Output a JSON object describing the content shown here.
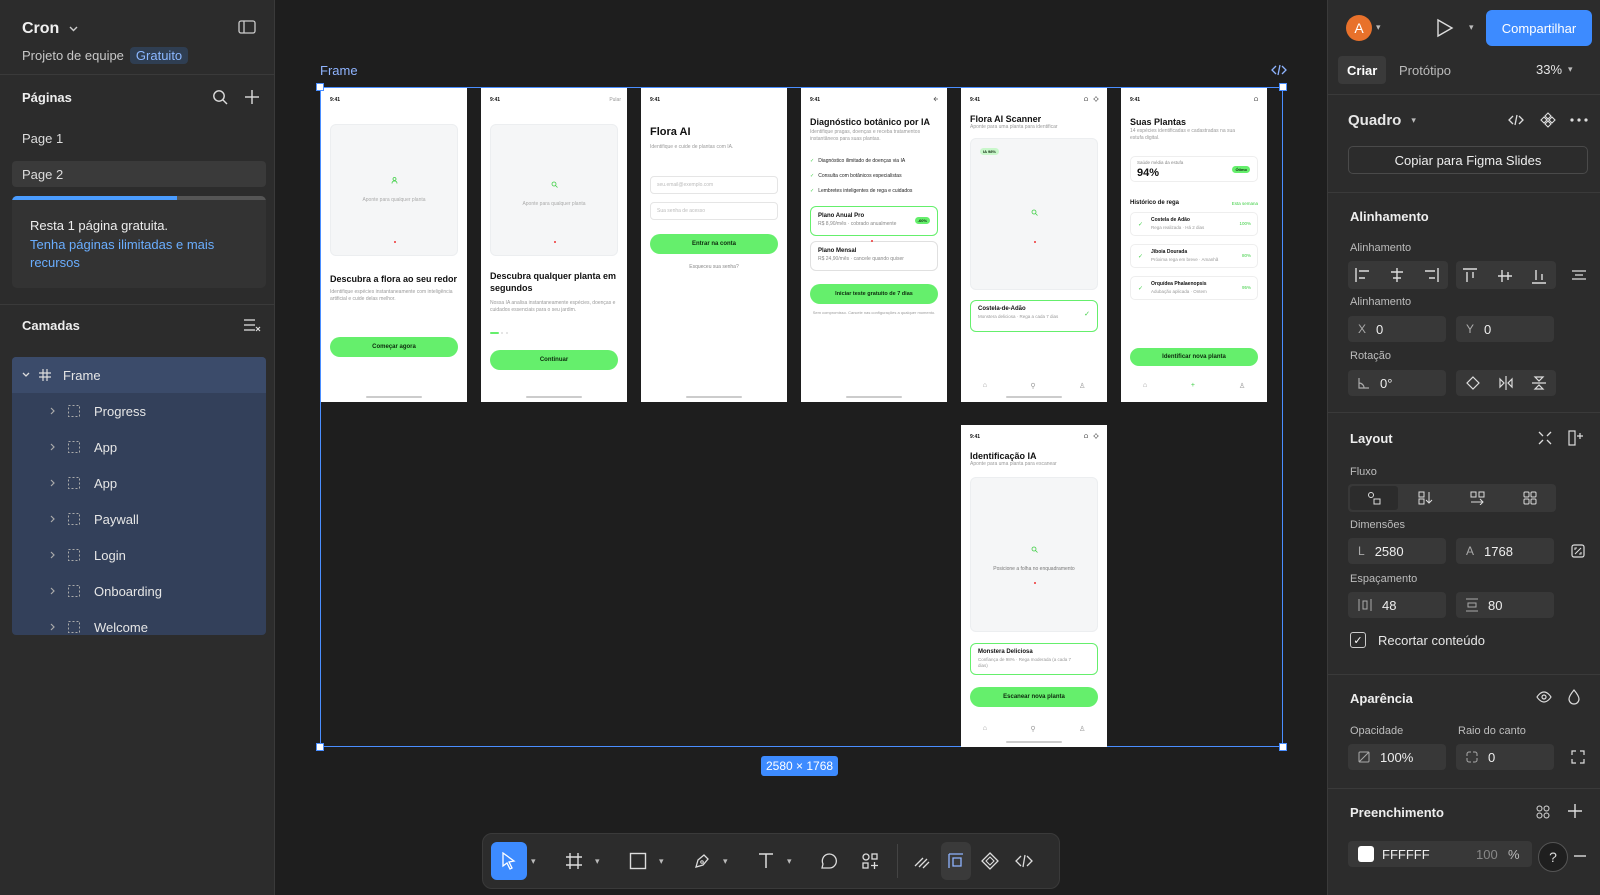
{
  "file": {
    "name": "Cron",
    "project": "Projeto de equipe",
    "plan_badge": "Gratuito"
  },
  "pages": {
    "title": "Páginas",
    "items": [
      {
        "label": "Page 1"
      },
      {
        "label": "Page 2"
      }
    ],
    "promo": {
      "line1": "Resta 1 página gratuita.",
      "link": "Tenha páginas ilimitadas e mais recursos",
      "progress": 0.65
    }
  },
  "layers": {
    "title": "Camadas",
    "root": "Frame",
    "children": [
      "Progress",
      "App",
      "App",
      "Paywall",
      "Login",
      "Onboarding",
      "Welcome"
    ]
  },
  "canvas": {
    "frame_label": "Frame",
    "dimensions": "2580 × 1768",
    "screens": {
      "time": "9:41",
      "welcome": {
        "placeholder": "Aponte para qualquer planta",
        "title": "Descubra a flora ao seu redor",
        "desc": "Identifique espécies instantaneamente com inteligência artificial e cuide delas melhor.",
        "button": "Começar agora"
      },
      "onboarding": {
        "skip": "Pular",
        "placeholder": "Aponte para qualquer planta",
        "title": "Descubra qualquer planta em segundos",
        "desc": "Nossa IA analisa instantaneamente espécies, doenças e cuidados essenciais para o seu jardim.",
        "button": "Continuar"
      },
      "login": {
        "title": "Flora AI",
        "desc": "Identifique e cuide de plantas com IA.",
        "email_ph": "seu.email@exemplo.com",
        "pass_ph": "Sua senha de acesso",
        "button": "Entrar na conta",
        "forgot": "Esqueceu sua senha?"
      },
      "paywall": {
        "title": "Diagnóstico botânico por IA",
        "desc": "Identifique pragas, doenças e receba tratamentos instantâneos para suas plantas.",
        "features": [
          "Diagnóstico ilimitado de doenças via IA",
          "Consulta com botânicos especialistas",
          "Lembretes inteligentes de rega e cuidados"
        ],
        "plan1_title": "Plano Anual Pro",
        "plan1_sub": "R$ 8,90/mês · cobrado anualmente",
        "plan1_badge": "-60%",
        "plan2_title": "Plano Mensal",
        "plan2_sub": "R$ 24,90/mês · cancele quando quiser",
        "button": "Iniciar teste gratuito de 7 dias",
        "footer": "Sem compromisso. Cancele nas configurações a qualquer momento."
      },
      "scanner": {
        "title": "Flora AI Scanner",
        "desc": "Aponte para uma planta para identificar",
        "badge": "IA 98%",
        "card_title": "Costela-de-Adão",
        "card_sub": "Monstera deliciosa · Rega a cada 7 dias"
      },
      "plants": {
        "title": "Suas Plantas",
        "desc": "14 espécies identificadas e cadastradas na sua estufa digital.",
        "health_label": "Saúde média da estufa",
        "health_value": "94%",
        "health_badge": "Ótimo",
        "history_title": "Histórico de rega",
        "history_link": "Esta semana",
        "history": [
          {
            "name": "Costela de Adão",
            "sub": "Rega realizada · Há 2 dias",
            "pct": "100%"
          },
          {
            "name": "Jiboia Dourada",
            "sub": "Próxima rega em breve · Amanhã",
            "pct": "80%"
          },
          {
            "name": "Orquídea Phalaenopsis",
            "sub": "Adubação aplicada · Ontem",
            "pct": "95%"
          }
        ],
        "button": "Identificar nova planta"
      },
      "progress": {
        "title": "Identificação IA",
        "desc": "Aponte para uma planta para escanear",
        "hint": "Posicione a folha no enquadramento",
        "card_title": "Monstera Deliciosa",
        "card_sub": "Confiança de 98% · Rega moderada (a cada 7 dias)",
        "button": "Escanear nova planta"
      }
    }
  },
  "right": {
    "avatar_letter": "A",
    "share": "Compartilhar",
    "tabs": [
      "Criar",
      "Protótipo"
    ],
    "zoom": "33%",
    "frame_type": "Quadro",
    "copy_slides": "Copiar para Figma Slides",
    "alignment_title": "Alinhamento",
    "alignment_label": "Alinhamento",
    "position_label": "Alinhamento",
    "x_label": "X",
    "x_value": "0",
    "y_label": "Y",
    "y_value": "0",
    "rotation_label": "Rotação",
    "rotation_value": "0°",
    "layout_title": "Layout",
    "flow_label": "Fluxo",
    "dimensions_label": "Dimensões",
    "w_label": "L",
    "w_value": "2580",
    "h_label": "A",
    "h_value": "1768",
    "spacing_label": "Espaçamento",
    "gap_h": "48",
    "gap_v": "80",
    "clip_label": "Recortar conteúdo",
    "appearance_title": "Aparência",
    "opacity_label": "Opacidade",
    "opacity_value": "100%",
    "radius_label": "Raio do canto",
    "radius_value": "0",
    "fill_title": "Preenchimento",
    "fill_hex": "FFFFFF",
    "fill_opacity": "100",
    "fill_pct": "%",
    "help": "?"
  }
}
